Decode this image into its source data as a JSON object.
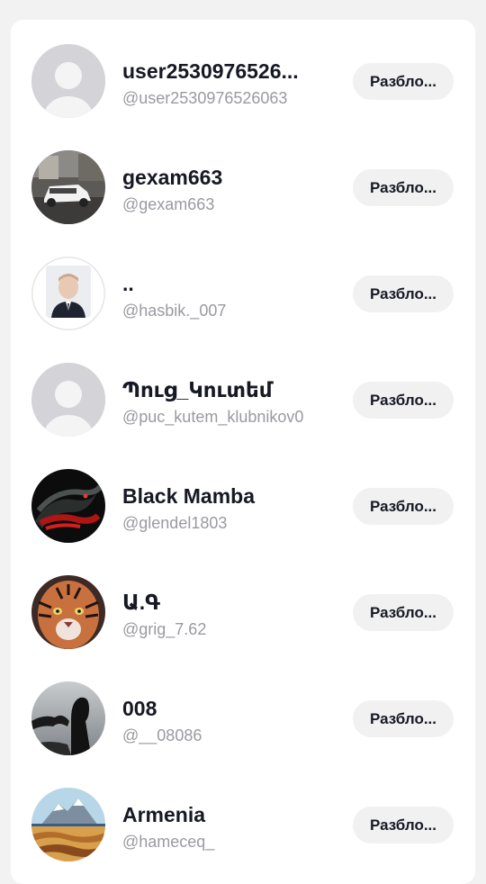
{
  "colors": {
    "background": "#f2f2f2",
    "card": "#ffffff",
    "button_bg": "#f1f1f2",
    "name_text": "#161823",
    "handle_text": "#9a9aa0"
  },
  "users": [
    {
      "name": "user2530976526...",
      "handle": "@user2530976526063",
      "button_label": "Разбло...",
      "avatar": "default-avatar-icon"
    },
    {
      "name": "gexam663",
      "handle": "@gexam663",
      "button_label": "Разбло...",
      "avatar": "car-photo"
    },
    {
      "name": "..",
      "handle": "@hasbik._007",
      "button_label": "Разбло...",
      "avatar": "portrait-photo"
    },
    {
      "name": "Պուց_Կուտեմ",
      "handle": "@puc_kutem_klubnikov0",
      "button_label": "Разбло...",
      "avatar": "default-avatar-icon"
    },
    {
      "name": "Black Mamba",
      "handle": "@glendel1803",
      "button_label": "Разбло...",
      "avatar": "snake-photo"
    },
    {
      "name": "Ա.Գ",
      "handle": "@grig_7.62",
      "button_label": "Разбло...",
      "avatar": "tiger-photo"
    },
    {
      "name": "008",
      "handle": "@__08086",
      "button_label": "Разбло...",
      "avatar": "silhouette-photo"
    },
    {
      "name": "Armenia",
      "handle": "@hameceq_",
      "button_label": "Разбло...",
      "avatar": "mountain-painting"
    }
  ]
}
